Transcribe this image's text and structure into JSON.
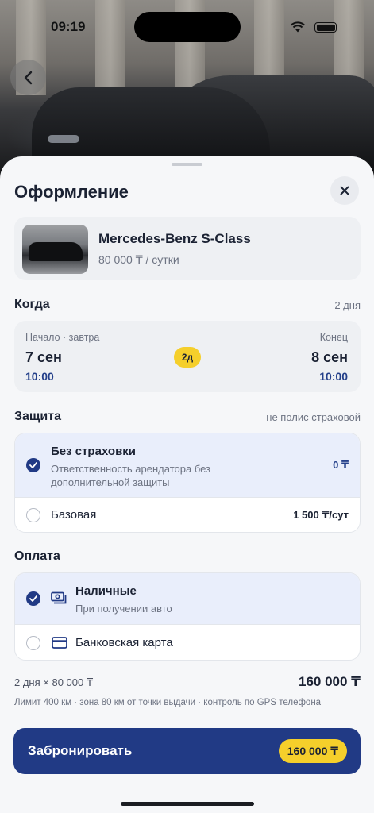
{
  "status_bar": {
    "time": "09:19"
  },
  "sheet": {
    "title": "Оформление",
    "car": {
      "name": "Mercedes-Benz S-Class",
      "price": "80 000 ₸ / сутки"
    },
    "when": {
      "title": "Когда",
      "meta": "2 дня",
      "start_label": "Начало · завтра",
      "start_date": "7 сен",
      "start_time": "10:00",
      "end_label": "Конец",
      "end_date": "8 сен",
      "end_time": "10:00",
      "days_badge": "2д"
    },
    "protection": {
      "title": "Защита",
      "meta": "не полис страховой",
      "options": [
        {
          "title": "Без страховки",
          "subtitle": "Ответственность арендатора без дополнительной защиты",
          "price": "0 ₸",
          "selected": true
        },
        {
          "title": "Базовая",
          "price": "1 500 ₸/сут",
          "selected": false
        }
      ]
    },
    "payment": {
      "title": "Оплата",
      "options": [
        {
          "title": "Наличные",
          "subtitle": "При получении авто",
          "icon": "cash-icon",
          "selected": true
        },
        {
          "title": "Банковская карта",
          "icon": "card-icon",
          "selected": false
        }
      ]
    },
    "summary": {
      "calc": "2 дня × 80 000 ₸",
      "total": "160 000 ₸",
      "note": "Лимит 400 км · зона 80 км от точки выдачи · контроль по GPS телефона"
    },
    "book_button": {
      "label": "Забронировать",
      "price": "160 000 ₸"
    }
  },
  "colors": {
    "accent": "#213a85",
    "highlight": "#f5cf2b",
    "selected_bg": "#e9eefb"
  }
}
